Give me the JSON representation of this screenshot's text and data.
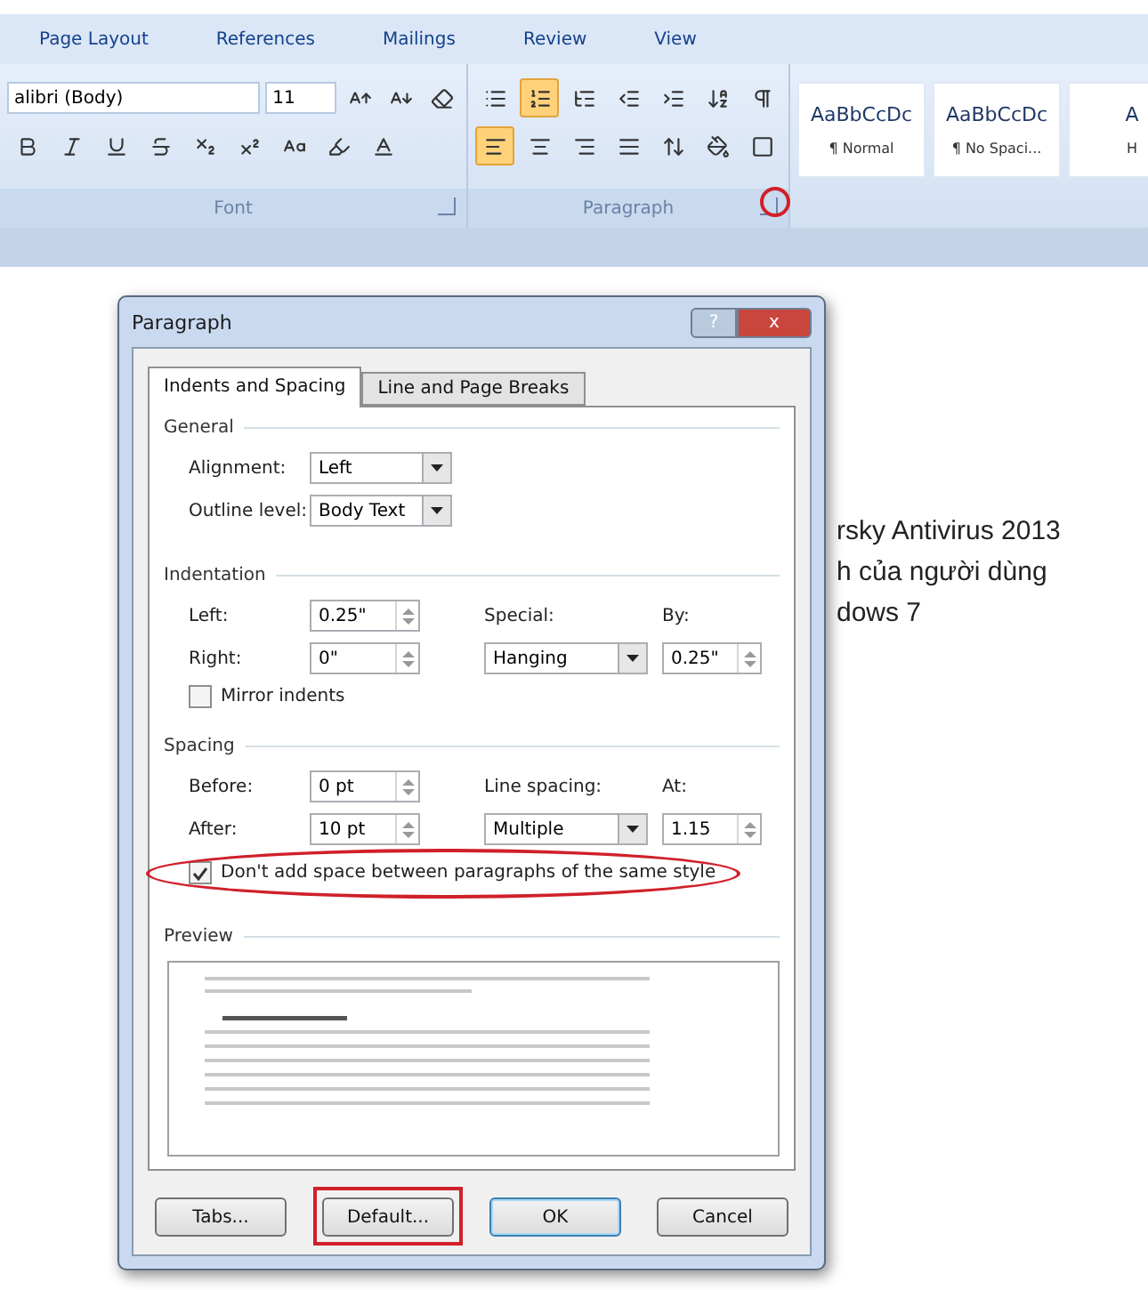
{
  "ribbon": {
    "tabs": [
      {
        "label": "Page Layout",
        "selected": false
      },
      {
        "label": "References",
        "selected": false
      },
      {
        "label": "Mailings",
        "selected": false
      },
      {
        "label": "Review",
        "selected": false
      },
      {
        "label": "View",
        "selected": false
      }
    ],
    "font_name": "alibri (Body)",
    "font_size": "11",
    "list_buttons": [
      {
        "kind": "bullets",
        "selected": false
      },
      {
        "kind": "numbering",
        "selected": true
      },
      {
        "kind": "multilevel",
        "selected": false
      }
    ],
    "align_buttons": [
      {
        "kind": "left",
        "selected": true
      },
      {
        "kind": "center",
        "selected": false
      },
      {
        "kind": "right",
        "selected": false
      },
      {
        "kind": "justify",
        "selected": false
      }
    ],
    "groups": [
      "Font",
      "Paragraph"
    ],
    "styles": [
      {
        "preview": "AaBbCcDc",
        "name": "¶ Normal"
      },
      {
        "preview": "AaBbCcDc",
        "name": "¶ No Spaci..."
      },
      {
        "preview": "A",
        "name": "H"
      }
    ]
  },
  "document": {
    "lines": [
      "rsky Antivirus 2013",
      "h của người dùng",
      "dows 7"
    ]
  },
  "dialog": {
    "title": "Paragraph",
    "help": "?",
    "close": "x",
    "tabs": [
      {
        "label": "Indents and Spacing",
        "selected": true
      },
      {
        "label": "Line and Page Breaks",
        "selected": false
      }
    ],
    "general": {
      "heading": "General",
      "alignment": {
        "label": "Alignment:",
        "value": "Left"
      },
      "outline": {
        "label": "Outline level:",
        "value": "Body Text"
      }
    },
    "indentation": {
      "heading": "Indentation",
      "left": {
        "label": "Left:",
        "value": "0.25\""
      },
      "right": {
        "label": "Right:",
        "value": "0\""
      },
      "special": {
        "label": "Special:",
        "value": "Hanging"
      },
      "by": {
        "label": "By:",
        "value": "0.25\""
      },
      "mirror": {
        "label": "Mirror indents",
        "checked": false
      }
    },
    "spacing": {
      "heading": "Spacing",
      "before": {
        "label": "Before:",
        "value": "0 pt"
      },
      "after": {
        "label": "After:",
        "value": "10 pt"
      },
      "line_spacing": {
        "label": "Line spacing:",
        "value": "Multiple"
      },
      "at": {
        "label": "At:",
        "value": "1.15"
      },
      "dont_add": {
        "label": "Don't add space between paragraphs of the same style",
        "checked": true
      }
    },
    "preview": {
      "heading": "Preview"
    },
    "buttons": [
      {
        "label": "Tabs...",
        "default": false,
        "highlighted": false
      },
      {
        "label": "Default...",
        "default": false,
        "highlighted": true
      },
      {
        "label": "OK",
        "default": true,
        "highlighted": false
      },
      {
        "label": "Cancel",
        "default": false,
        "highlighted": false
      }
    ]
  }
}
